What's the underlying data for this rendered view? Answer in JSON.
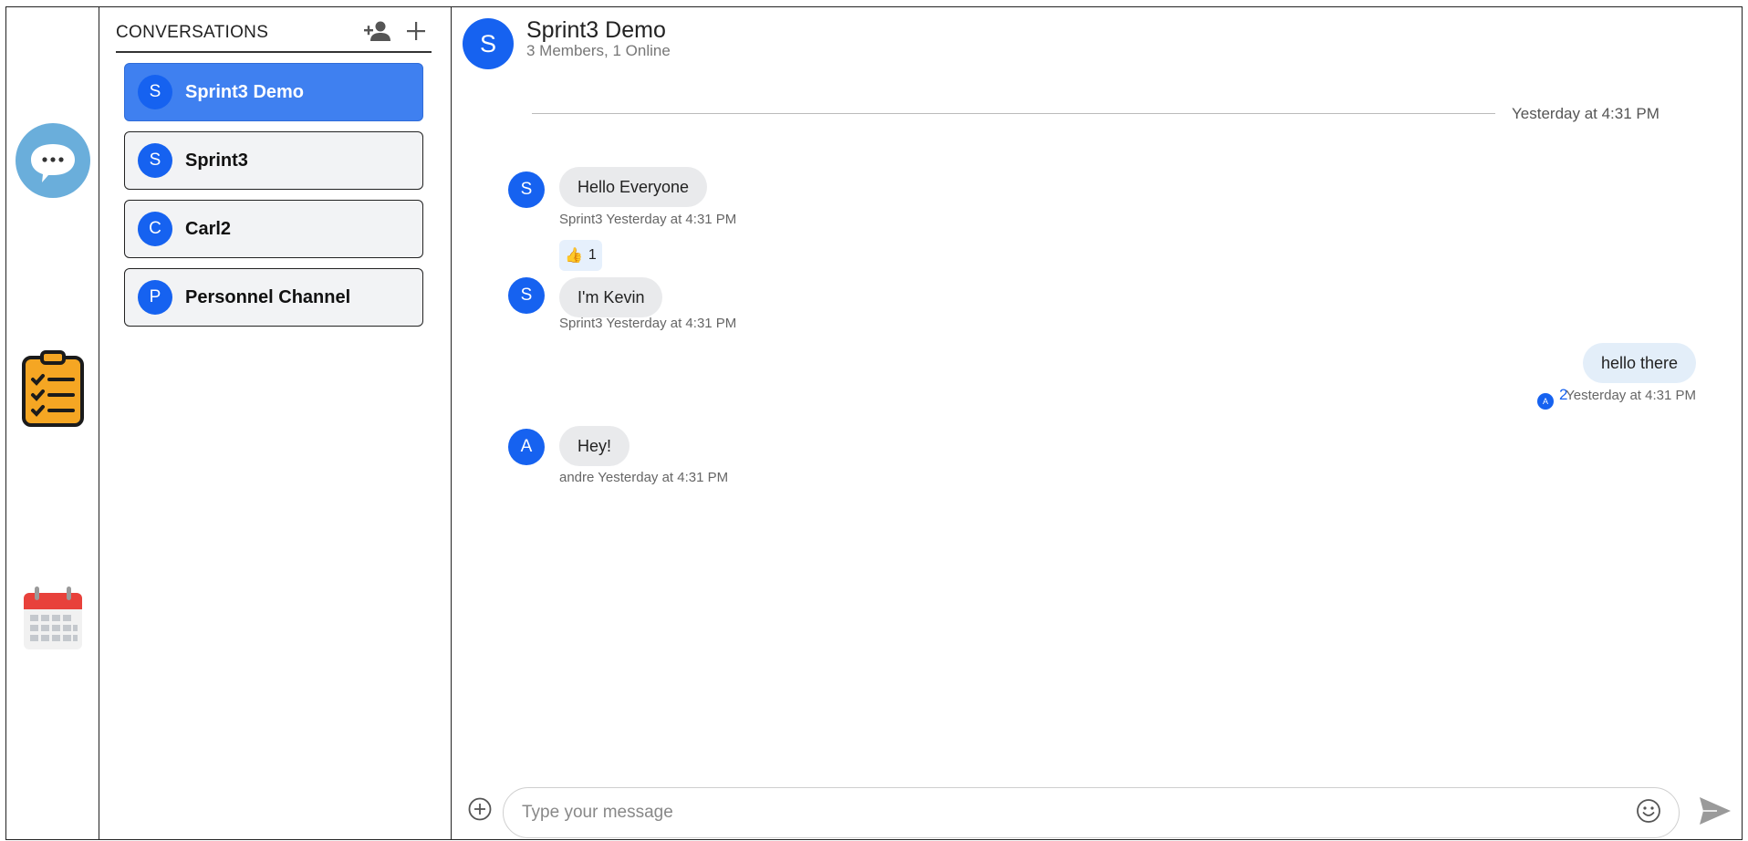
{
  "rail": {
    "items": [
      {
        "icon": "chat-bubble-icon",
        "color": "#6aaedb"
      },
      {
        "icon": "clipboard-checklist-icon",
        "color": "#f5a623"
      },
      {
        "icon": "calendar-icon",
        "color": "#e8413b"
      }
    ]
  },
  "conversations": {
    "title": "CONVERSATIONS",
    "add_member_icon": "add-person-icon",
    "new_icon": "plus-icon",
    "items": [
      {
        "initial": "S",
        "name": "Sprint3 Demo",
        "active": true
      },
      {
        "initial": "S",
        "name": "Sprint3",
        "active": false
      },
      {
        "initial": "C",
        "name": "Carl2",
        "active": false
      },
      {
        "initial": "P",
        "name": "Personnel Channel",
        "active": false
      }
    ]
  },
  "chat": {
    "avatar_initial": "S",
    "title": "Sprint3 Demo",
    "subtitle": "3 Members, 1 Online",
    "divider_label": "Yesterday at 4:31 PM",
    "messages": [
      {
        "initial": "S",
        "text": "Hello Everyone",
        "meta": "Sprint3 Yesterday at 4:31 PM"
      },
      {
        "reaction_emoji": "👍",
        "reaction_count": "1"
      },
      {
        "initial": "S",
        "text": "I'm Kevin",
        "meta": "Sprint3 Yesterday at 4:31 PM"
      },
      {
        "text": "hello there",
        "read_initial": "A",
        "read_count": "2",
        "meta": "Yesterday at 4:31 PM"
      },
      {
        "initial": "A",
        "text": "Hey!",
        "meta": "andre Yesterday at 4:31 PM"
      }
    ]
  },
  "composer": {
    "placeholder": "Type your message",
    "value": ""
  },
  "colors": {
    "accent": "#1662f0",
    "active_item": "#3f80f0"
  }
}
